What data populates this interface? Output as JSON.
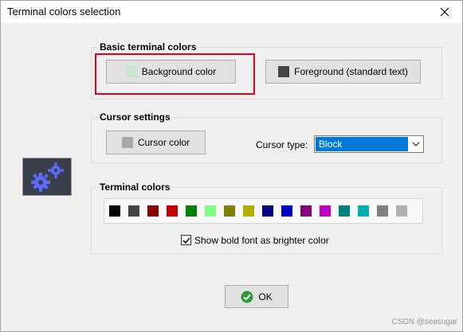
{
  "window": {
    "title": "Terminal colors selection"
  },
  "basic_group": {
    "title": "Basic terminal colors",
    "background_button": {
      "label": "Background color",
      "swatch": "#c8e6c9"
    },
    "foreground_button": {
      "label": "Foreground (standard text)",
      "swatch": "#444444"
    }
  },
  "cursor_group": {
    "title": "Cursor settings",
    "cursor_color_button": {
      "label": "Cursor color",
      "swatch": "#a8a8a8"
    },
    "cursor_type_label": "Cursor type:",
    "cursor_type_value": "Block"
  },
  "terminal_colors_group": {
    "title": "Terminal colors",
    "palette": [
      "#000000",
      "#444444",
      "#8b0000",
      "#c00000",
      "#008000",
      "#80ff80",
      "#808000",
      "#b0b000",
      "#000080",
      "#0000c0",
      "#800080",
      "#c000c0",
      "#008080",
      "#00b0b0",
      "#808080",
      "#b0b0b0"
    ],
    "bold_checkbox_label": "Show bold font as brighter color",
    "bold_checkbox_checked": true
  },
  "ok_button": {
    "label": "OK"
  },
  "watermark": "CSDN @seasugar",
  "colors": {
    "accent": "#0078d7",
    "highlight": "#e5001a",
    "icon_blue": "#5a6cff"
  }
}
